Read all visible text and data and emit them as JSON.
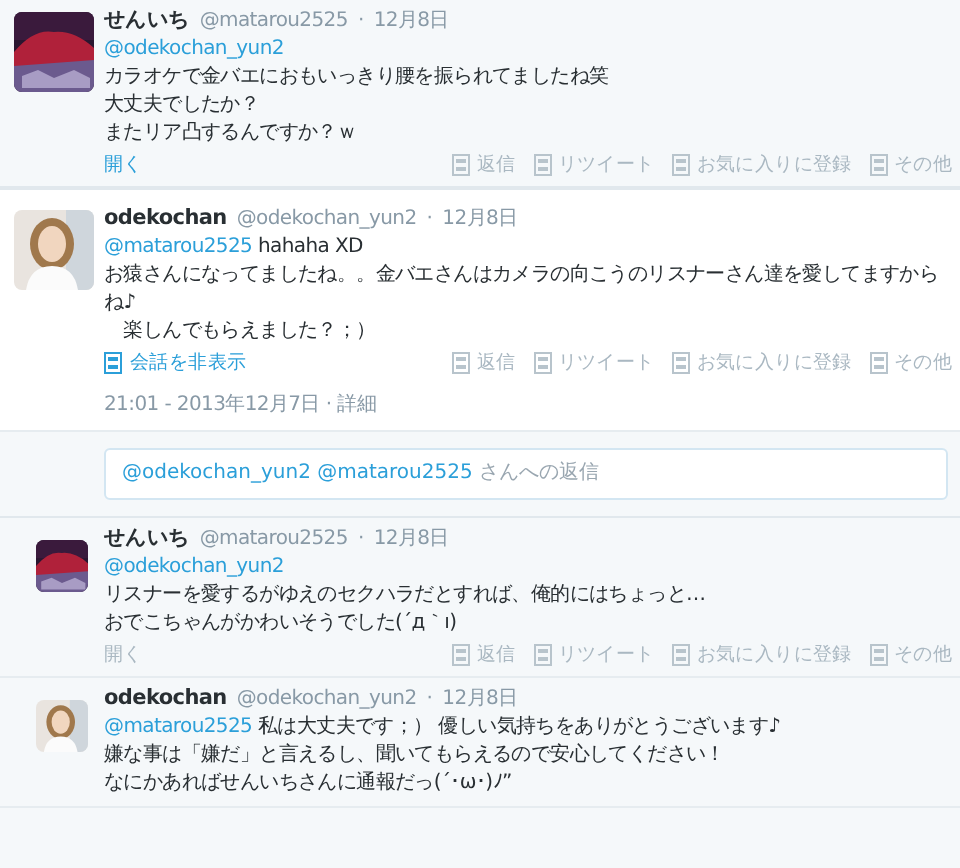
{
  "tweets": [
    {
      "kind": "context",
      "name": "せんいち",
      "handle": "@matarou2525",
      "separator": "·",
      "date": "12月8日",
      "lines": [
        {
          "mention": "@odekochan_yun2"
        },
        {
          "text": "カラオケで金バエにおもいっきり腰を振られてましたね笑"
        },
        {
          "text": "大丈夫でしたか？"
        },
        {
          "text": "またリア凸するんですか？ｗ"
        }
      ],
      "link": {
        "label": "開く",
        "active": true
      },
      "actions": [
        "返信",
        "リツイート",
        "お気に入りに登録",
        "その他"
      ]
    },
    {
      "kind": "main",
      "name": "odekochan",
      "handle": "@odekochan_yun2",
      "separator": "·",
      "date": "12月8日",
      "lines": [
        {
          "mention": "@matarou2525",
          "text": "hahaha XD"
        },
        {
          "text": "お猿さんになってましたね。。金バエさんはカメラの向こうのリスナーさん達を愛してますからね♪"
        },
        {
          "text": "　楽しんでもらえました？；）"
        }
      ],
      "link": {
        "label": "会話を非表示",
        "active": true,
        "icon": true
      },
      "actions": [
        "返信",
        "リツイート",
        "お気に入りに登録",
        "その他"
      ],
      "timestamp": "21:01 - 2013年12月7日",
      "timestamp_separator": "·",
      "detail": "詳細"
    }
  ],
  "reply_box": {
    "mentions": "@odekochan_yun2 @matarou2525",
    "placeholder": "さんへの返信"
  },
  "replies": [
    {
      "kind": "reply",
      "name": "せんいち",
      "handle": "@matarou2525",
      "separator": "·",
      "date": "12月8日",
      "lines": [
        {
          "mention": "@odekochan_yun2"
        },
        {
          "text": "リスナーを愛するがゆえのセクハラだとすれば、俺的にはちょっと…"
        },
        {
          "text": "おでこちゃんがかわいそうでした(´д｀ı)"
        }
      ],
      "link": {
        "label": "開く",
        "active": false
      },
      "actions": [
        "返信",
        "リツイート",
        "お気に入りに登録",
        "その他"
      ]
    },
    {
      "kind": "reply",
      "name": "odekochan",
      "handle": "@odekochan_yun2",
      "separator": "·",
      "date": "12月8日",
      "lines": [
        {
          "mention": "@matarou2525",
          "text": "私は大丈夫です；）  優しい気持ちをありがとうございます♪"
        },
        {
          "text": "嫌な事は「嫌だ」と言えるし、聞いてもらえるので安心してください！"
        },
        {
          "text": "なにかあればせんいちさんに通報だっ(´･ω･)ﾉ”"
        }
      ]
    }
  ]
}
